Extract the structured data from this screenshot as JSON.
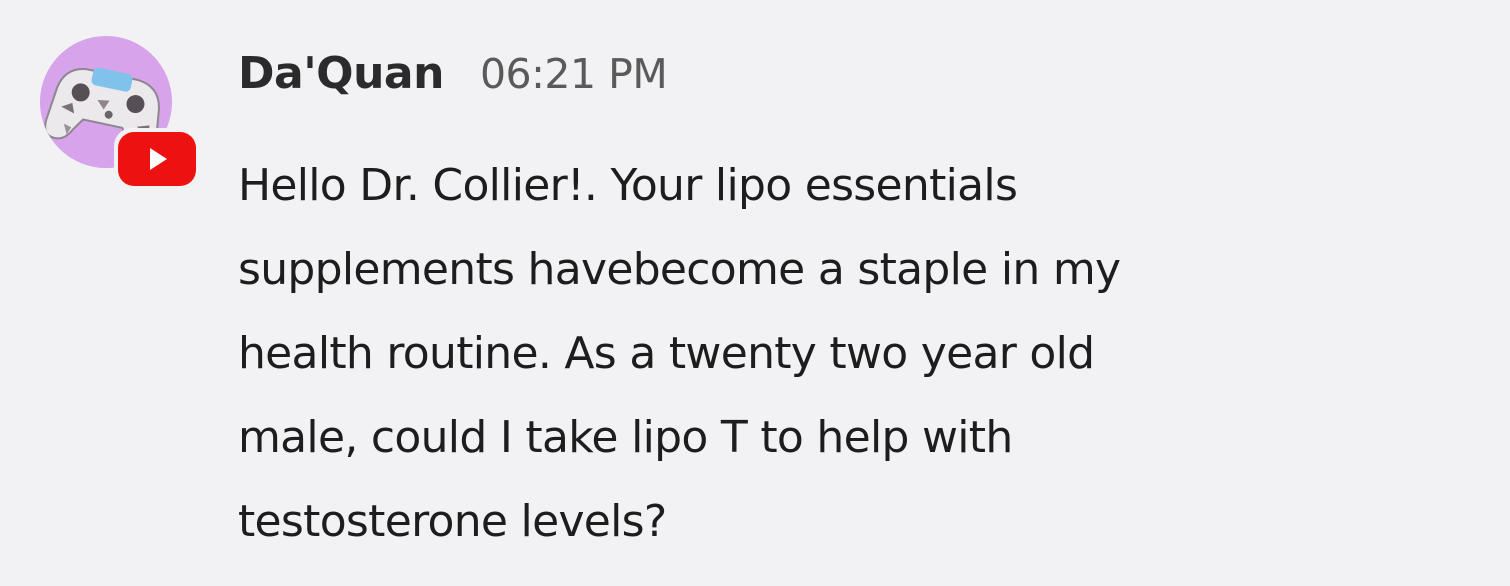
{
  "message": {
    "author": "Da'Quan",
    "timestamp": "06:21 PM",
    "text_lines": [
      "Hello Dr. Collier!. Your lipo essentials",
      "supplements havebecome a staple in my",
      "health routine. As a twenty two year old",
      "male, could I take lipo T to help with",
      "testosterone levels?"
    ],
    "avatar": {
      "icon": "game-controller-icon",
      "background_color": "#d7a3ea"
    },
    "platform_badge": {
      "icon": "youtube-icon",
      "color": "#ee1111"
    }
  },
  "colors": {
    "background": "#f2f2f4",
    "author_text": "#2b2b2b",
    "timestamp_text": "#5a5a5a",
    "body_text": "#1d1d1d"
  }
}
